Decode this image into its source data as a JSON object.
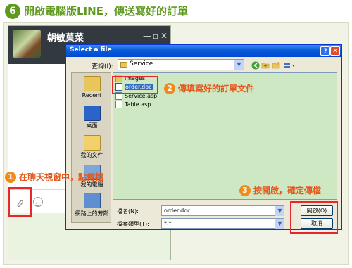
{
  "step": {
    "number": "6",
    "title": "開啟電腦版LINE，傳送寫好的訂單"
  },
  "line_window": {
    "contact_name": "朝敏菓菜",
    "controls": {
      "minimize": "—",
      "maximize": "▫",
      "close": "✕"
    }
  },
  "dialog": {
    "title": "Select a file",
    "help": "?",
    "close": "✕",
    "look_in_label": "查詢(I):",
    "look_in_value": "Service",
    "places": [
      {
        "label": "Recent",
        "icon": "recent-folder-icon"
      },
      {
        "label": "桌面",
        "icon": "desktop-icon"
      },
      {
        "label": "我的文件",
        "icon": "my-documents-icon"
      },
      {
        "label": "我的電腦",
        "icon": "my-computer-icon"
      },
      {
        "label": "網路上的芳鄰",
        "icon": "network-icon"
      }
    ],
    "files": [
      {
        "name": "images",
        "type": "folder"
      },
      {
        "name": "order.doc",
        "type": "doc",
        "selected": true
      },
      {
        "name": "Service.asp",
        "type": "asp"
      },
      {
        "name": "Table.asp",
        "type": "asp"
      }
    ],
    "file_name_label": "檔名(N):",
    "file_name_value": "order.doc",
    "file_type_label": "檔案類型(T):",
    "file_type_value": "*.*",
    "open_button": "開啟(O)",
    "cancel_button": "取消"
  },
  "callouts": [
    {
      "number": "1",
      "text": "在聊天視窗中，點傳檔"
    },
    {
      "number": "2",
      "text": "傳填寫好的訂單文件"
    },
    {
      "number": "3",
      "text": "按開啟，確定傳檔"
    }
  ],
  "colors": {
    "accent_green": "#5f9a1e",
    "callout_orange": "#f08a1c",
    "highlight_red": "#e8272a",
    "file_list_bg": "#cde8c3"
  }
}
